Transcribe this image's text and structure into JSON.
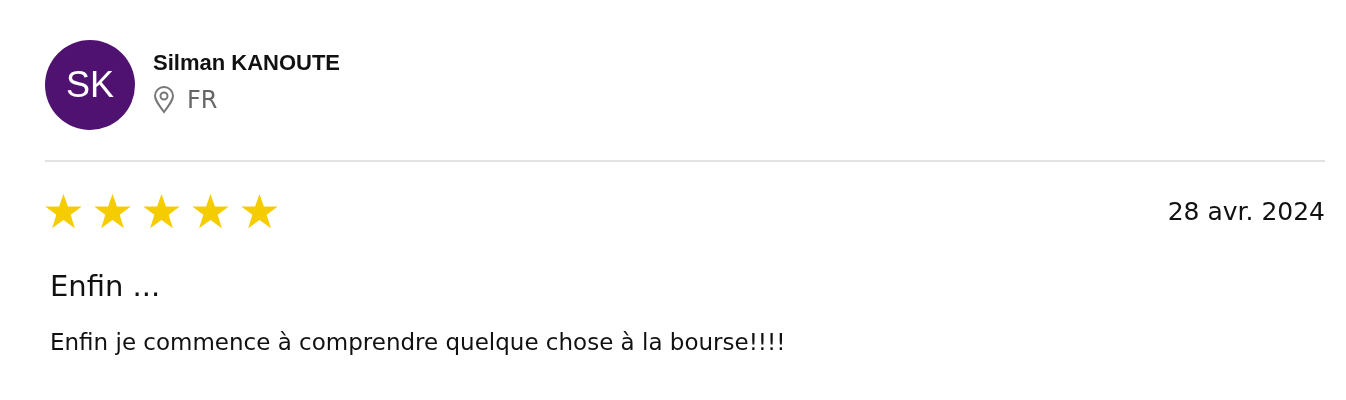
{
  "reviewer": {
    "initials": "SK",
    "name": "Silman KANOUTE",
    "country": "FR"
  },
  "review": {
    "stars": 5,
    "date": "28 avr. 2024",
    "title": "Enfin ...",
    "body": "Enfin je commence à comprendre quelque chose à la bourse!!!!"
  }
}
